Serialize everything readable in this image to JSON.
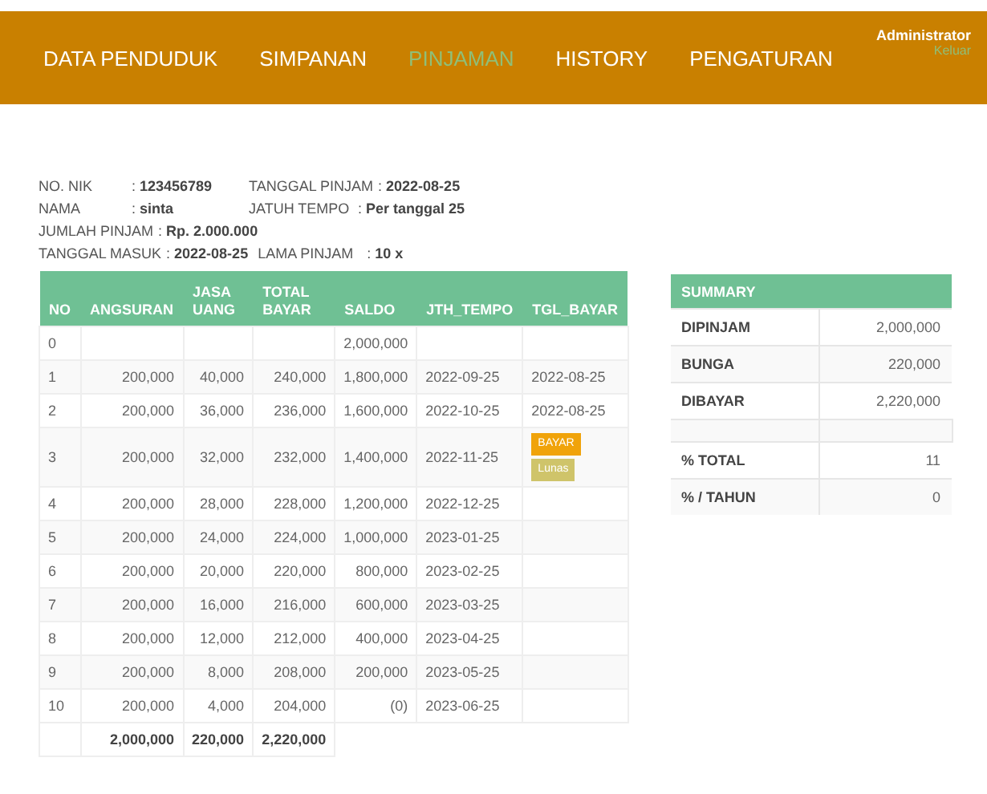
{
  "nav": {
    "items": [
      {
        "label": "DATA PENDUDUK",
        "selected": false
      },
      {
        "label": "SIMPANAN",
        "selected": false
      },
      {
        "label": "PINJAMAN",
        "selected": true
      },
      {
        "label": "HISTORY",
        "selected": false
      },
      {
        "label": "PENGATURAN",
        "selected": false
      }
    ],
    "user": "Administrator",
    "logout": "Keluar"
  },
  "info": [
    [
      {
        "label": "NO. NIK",
        "value": ": **123456789**"
      },
      {
        "label": "TANGGAL PINJAM",
        "value": ": **2022-08-25**"
      }
    ],
    [
      {
        "label": "NAMA",
        "value": ": **sinta**"
      },
      {
        "label": "JATUH TEMPO",
        "value": ": **Per tanggal 25**"
      }
    ],
    [
      {
        "label": "JUMLAH PINJAM",
        "value": ": **Rp. 2.000.000**"
      }
    ],
    [
      {
        "label": "TANGGAL MASUK",
        "value": ": **2022-08-25**"
      },
      {
        "label": "LAMA PINJAM",
        "value": ": **10 x**"
      }
    ]
  ],
  "table": {
    "columns": [
      "NO",
      "ANGSURAN",
      "JASA UANG",
      "TOTAL BAYAR",
      "SALDO",
      "JTH_TEMPO",
      "TGL_BAYAR"
    ],
    "rows": [
      {
        "cells": [
          "0",
          "",
          "",
          "",
          "2,000,000",
          "",
          ""
        ]
      },
      {
        "cells": [
          "1",
          "200,000",
          "40,000",
          "240,000",
          "1,800,000",
          "2022-09-25",
          "2022-08-25"
        ]
      },
      {
        "cells": [
          "2",
          "200,000",
          "36,000",
          "236,000",
          "1,600,000",
          "2022-10-25",
          "2022-08-25"
        ]
      },
      {
        "cells": [
          "3",
          "200,000",
          "32,000",
          "232,000",
          "1,400,000",
          "2022-11-25",
          ""
        ],
        "actions": [
          {
            "label": "BAYAR",
            "kind": "pay"
          },
          {
            "label": "Lunas",
            "kind": "paid"
          }
        ]
      },
      {
        "cells": [
          "4",
          "200,000",
          "28,000",
          "228,000",
          "1,200,000",
          "2022-12-25",
          ""
        ]
      },
      {
        "cells": [
          "5",
          "200,000",
          "24,000",
          "224,000",
          "1,000,000",
          "2023-01-25",
          ""
        ]
      },
      {
        "cells": [
          "6",
          "200,000",
          "20,000",
          "220,000",
          "800,000",
          "2023-02-25",
          ""
        ]
      },
      {
        "cells": [
          "7",
          "200,000",
          "16,000",
          "216,000",
          "600,000",
          "2023-03-25",
          ""
        ]
      },
      {
        "cells": [
          "8",
          "200,000",
          "12,000",
          "212,000",
          "400,000",
          "2023-04-25",
          ""
        ]
      },
      {
        "cells": [
          "9",
          "200,000",
          "8,000",
          "208,000",
          "200,000",
          "2023-05-25",
          ""
        ]
      },
      {
        "cells": [
          "10",
          "200,000",
          "4,000",
          "204,000",
          "(0)",
          "2023-06-25",
          ""
        ]
      }
    ],
    "totals": [
      "2,000,000",
      "220,000",
      "2,220,000"
    ]
  },
  "summary": {
    "title": "SUMMARY",
    "rows": [
      {
        "kind": "item",
        "label": "DIPINJAM",
        "value": "2,000,000"
      },
      {
        "kind": "item",
        "label": "BUNGA",
        "value": "220,000"
      },
      {
        "kind": "item",
        "label": "DIBAYAR",
        "value": "2,220,000"
      },
      {
        "kind": "spacer"
      },
      {
        "kind": "item",
        "label": "% TOTAL",
        "value": "11"
      },
      {
        "kind": "item",
        "label": "% / TAHUN",
        "value": "0"
      }
    ]
  }
}
